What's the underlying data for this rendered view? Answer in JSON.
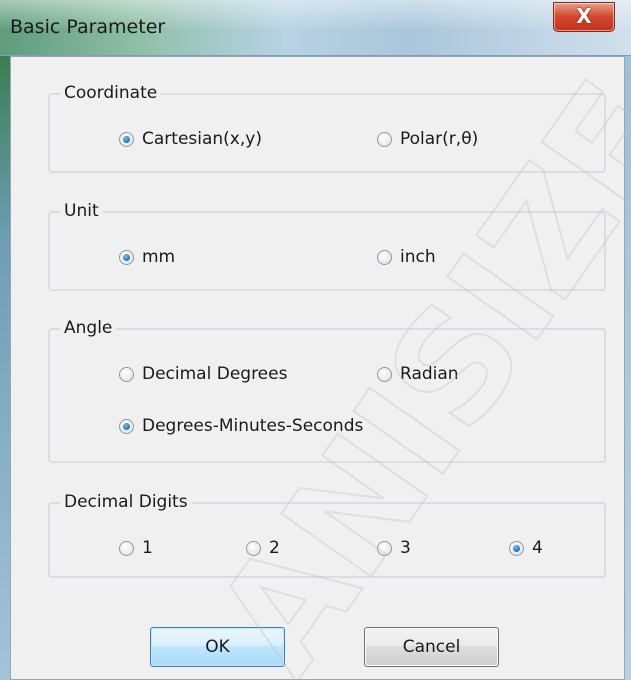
{
  "window": {
    "title": "Basic Parameter",
    "close_glyph": "X"
  },
  "coordinate": {
    "label": "Coordinate",
    "options": [
      {
        "label": "Cartesian(x,y)",
        "checked": true
      },
      {
        "label": "Polar(r,θ)",
        "checked": false
      }
    ]
  },
  "unit": {
    "label": "Unit",
    "options": [
      {
        "label": "mm",
        "checked": true
      },
      {
        "label": "inch",
        "checked": false
      }
    ]
  },
  "angle": {
    "label": "Angle",
    "options": [
      {
        "label": "Decimal Degrees",
        "checked": false
      },
      {
        "label": "Radian",
        "checked": false
      },
      {
        "label": "Degrees-Minutes-Seconds",
        "checked": true
      }
    ]
  },
  "decimal_digits": {
    "label": "Decimal Digits",
    "options": [
      {
        "label": "1",
        "checked": false
      },
      {
        "label": "2",
        "checked": false
      },
      {
        "label": "3",
        "checked": false
      },
      {
        "label": "4",
        "checked": true
      }
    ]
  },
  "buttons": {
    "ok": "OK",
    "cancel": "Cancel"
  },
  "watermark": {
    "text": "ANISIZE"
  },
  "colors": {
    "accent_radio": "#1f6fb8",
    "close_button": "#d2462a",
    "group_border": "#d5dfe5",
    "client_background": "#f0f0f0"
  }
}
